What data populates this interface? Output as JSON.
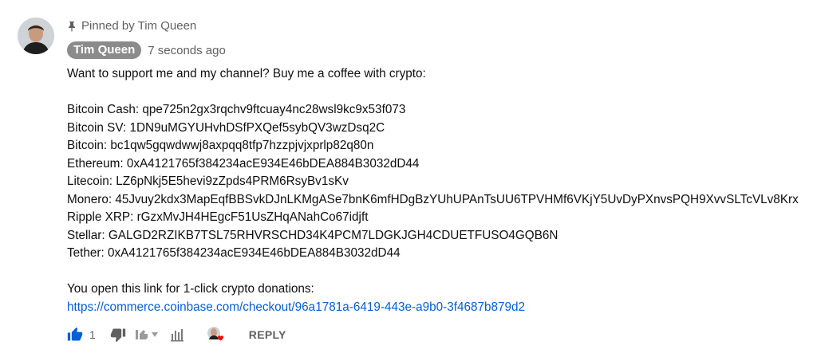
{
  "pinned_label": "Pinned by Tim Queen",
  "author": {
    "name": "Tim Queen",
    "time": "7 seconds ago"
  },
  "comment": {
    "intro": "Want to support me and my channel? Buy me a coffee with crypto:",
    "addresses": [
      "Bitcoin Cash: qpe725n2gx3rqchv9ftcuay4nc28wsl9kc9x53f073",
      "Bitcoin SV: 1DN9uMGYUHvhDSfPXQef5sybQV3wzDsq2C",
      "Bitcoin: bc1qw5gqwdwwj8axpqq8tfp7hzzpjvjxprlp82q80n",
      "Ethereum: 0xA4121765f384234acE934E46bDEA884B3032dD44",
      "Litecoin: LZ6pNkj5E5hevi9zZpds4PRM6RsyBv1sKv",
      "Monero: 45Jvuy2kdx3MapEqfBBSvkDJnLKMgASe7bnK6mfHDgBzYUhUPAnTsUU6TPVHMf6VKjY5UvDyPXnvsPQH9XvvSLTcVLv8Krx",
      "Ripple XRP: rGzxMvJH4HEgcF51UsZHqANahCo67idjft",
      "Stellar: GALGD2RZIKB7TSL75RHVRSCHD34K4PCM7LDGKJGH4CDUETFUSO4GQB6N",
      "Tether: 0xA4121765f384234acE934E46bDEA884B3032dD44"
    ],
    "link_intro": "You open this link for 1-click crypto donations:",
    "link": "https://commerce.coinbase.com/checkout/96a1781a-6419-443e-a9b0-3f4687b879d2"
  },
  "actions": {
    "like_count": "1",
    "reply_label": "REPLY"
  },
  "colors": {
    "link": "#065fd4",
    "like_active": "#065fd4",
    "heart": "#ff0000",
    "chip": "#8b8b8b"
  }
}
